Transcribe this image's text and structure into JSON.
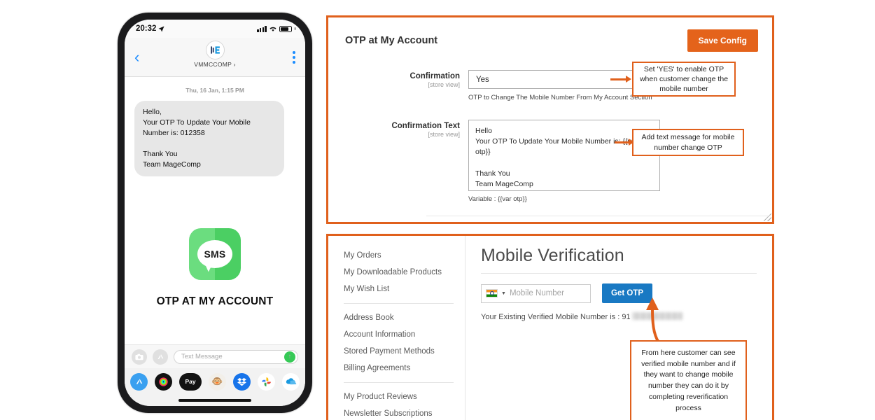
{
  "phone": {
    "status_bar": {
      "time": "20:32",
      "location_icon": "location-arrow-icon",
      "signal_icon": "signal-bars-icon",
      "wifi_icon": "wifi-icon",
      "battery_icon": "battery-icon"
    },
    "header": {
      "back_icon": "back-chevron-icon",
      "contact_name": "VMMCCOMP ›",
      "avatar_icon": "magecomp-logo-icon",
      "menu_icon": "kebab-menu-icon"
    },
    "thread": {
      "timestamp": "Thu, 16 Jan, 1:15 PM",
      "message": "Hello,\nYour OTP To Update Your Mobile Number is: 012358\n\nThank You\nTeam MageComp"
    },
    "promo": {
      "app_icon_label": "SMS",
      "caption": "OTP AT MY ACCOUNT"
    },
    "compose": {
      "camera_icon": "camera-icon",
      "appstore_icon": "app-store-icon",
      "placeholder": "Text Message",
      "send_icon": "send-arrow-icon"
    },
    "app_drawer": [
      {
        "name": "app-store-icon",
        "glyph": "A",
        "bg": "#3aa0f0"
      },
      {
        "name": "activity-rings-icon",
        "glyph": "◉",
        "bg": "#111111"
      },
      {
        "name": "apple-pay-icon",
        "glyph": "Pay",
        "bg": "#111111"
      },
      {
        "name": "memoji-icon",
        "glyph": "🐵",
        "bg": "#f4f4f4"
      },
      {
        "name": "dropbox-icon",
        "glyph": "▼",
        "bg": "#1774ea"
      },
      {
        "name": "google-photos-icon",
        "glyph": "✦",
        "bg": "#ffffff"
      },
      {
        "name": "onedrive-icon",
        "glyph": "☁",
        "bg": "#ffffff"
      }
    ]
  },
  "config_panel": {
    "title": "OTP at My Account",
    "save_label": "Save Config",
    "confirmation": {
      "label": "Confirmation",
      "scope": "[store view]",
      "value": "Yes",
      "hint": "OTP to Change The Mobile Number From My Account Section"
    },
    "confirmation_text": {
      "label": "Confirmation Text",
      "scope": "[store view]",
      "value": "Hello\nYour OTP To Update Your Mobile Number is: {{var otp}}\n\nThank You\nTeam MageComp",
      "variable_hint": "Variable : {{var otp}}"
    }
  },
  "account_panel": {
    "nav_group_1": [
      "My Orders",
      "My Downloadable Products",
      "My Wish List"
    ],
    "nav_group_2": [
      "Address Book",
      "Account Information",
      "Stored Payment Methods",
      "Billing Agreements"
    ],
    "nav_group_3": [
      "My Product Reviews",
      "Newsletter Subscriptions"
    ],
    "title": "Mobile Verification",
    "country_flag": "india-flag-icon",
    "mobile_placeholder": "Mobile Number",
    "get_otp_label": "Get OTP",
    "verified_note": "Your Existing Verified Mobile Number is : 91"
  },
  "callouts": {
    "one": "Set 'YES' to enable OTP when customer change the mobile number",
    "two": "Add text message for mobile number change OTP",
    "three": "From here customer can see verified mobile number and if they want to change mobile number they can do it by completing reverification process"
  },
  "colors": {
    "accent_orange": "#e0601c",
    "save_button": "#e4631b",
    "get_otp_blue": "#1979c3",
    "sms_green": "#5bd473"
  }
}
